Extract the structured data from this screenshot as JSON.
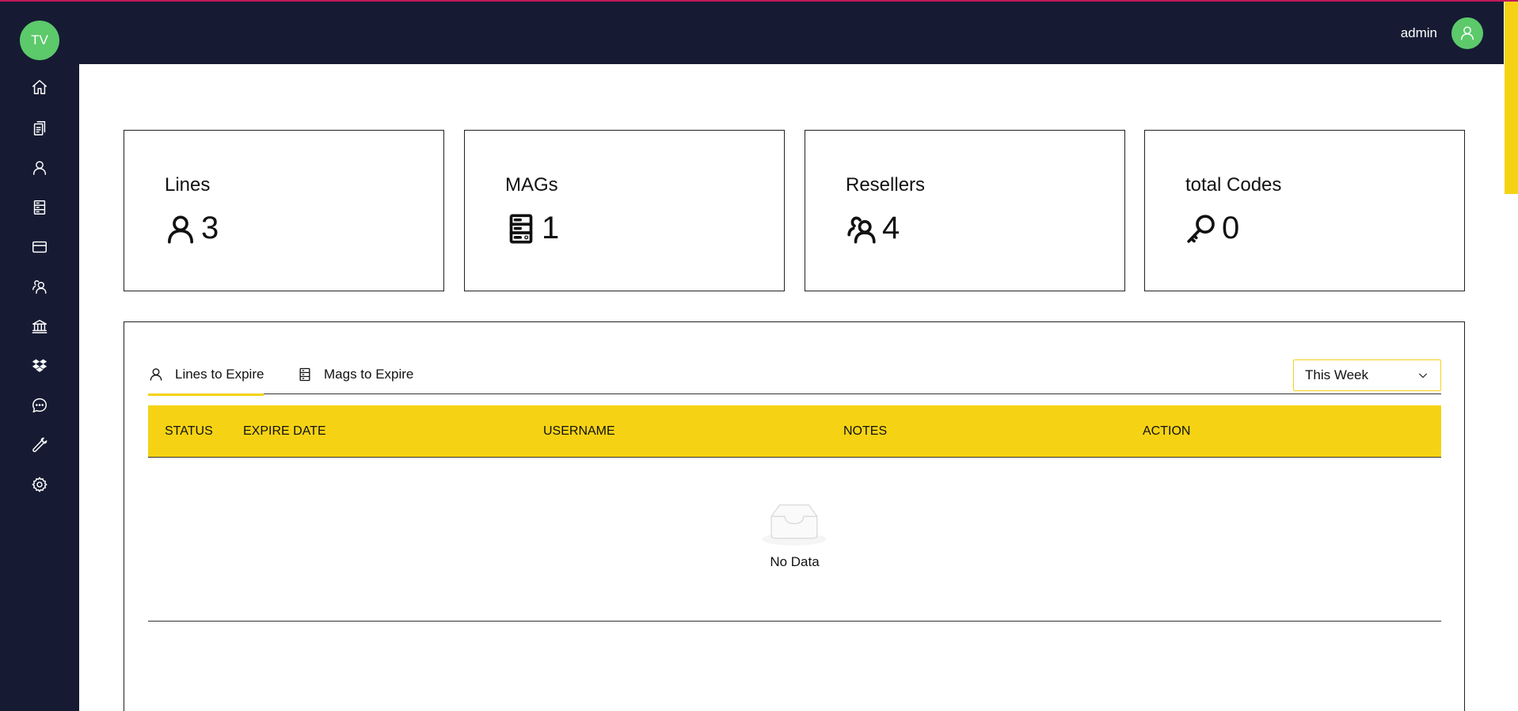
{
  "sidebar": {
    "logo_text": "TV",
    "logo_color": "#5cc96b",
    "background": "#161b33",
    "items": [
      {
        "icon": "home-icon"
      },
      {
        "icon": "clipboard-icon"
      },
      {
        "icon": "user-icon"
      },
      {
        "icon": "server-icon"
      },
      {
        "icon": "credit-card-icon"
      },
      {
        "icon": "users-icon"
      },
      {
        "icon": "bank-icon"
      },
      {
        "icon": "dropbox-icon"
      },
      {
        "icon": "chat-icon"
      },
      {
        "icon": "tool-icon"
      },
      {
        "icon": "gear-icon"
      }
    ]
  },
  "header": {
    "username": "admin",
    "avatar_icon": "user-icon"
  },
  "stats": [
    {
      "label": "Lines",
      "value": "3",
      "icon": "user-icon"
    },
    {
      "label": "MAGs",
      "value": "1",
      "icon": "server-icon"
    },
    {
      "label": "Resellers",
      "value": "4",
      "icon": "users-icon"
    },
    {
      "label": "total Codes",
      "value": "0",
      "icon": "key-icon"
    }
  ],
  "panel": {
    "tabs": [
      {
        "label": "Lines to Expire",
        "icon": "user-icon",
        "active": true
      },
      {
        "label": "Mags to Expire",
        "icon": "server-icon",
        "active": false
      }
    ],
    "period_select": {
      "value": "This Week"
    },
    "table": {
      "columns": [
        "STATUS",
        "EXPIRE DATE",
        "USERNAME",
        "NOTES",
        "ACTION"
      ],
      "rows": [],
      "empty_text": "No Data"
    }
  },
  "colors": {
    "accent": "#f5d314",
    "dark": "#161b33",
    "green": "#5cc96b"
  }
}
